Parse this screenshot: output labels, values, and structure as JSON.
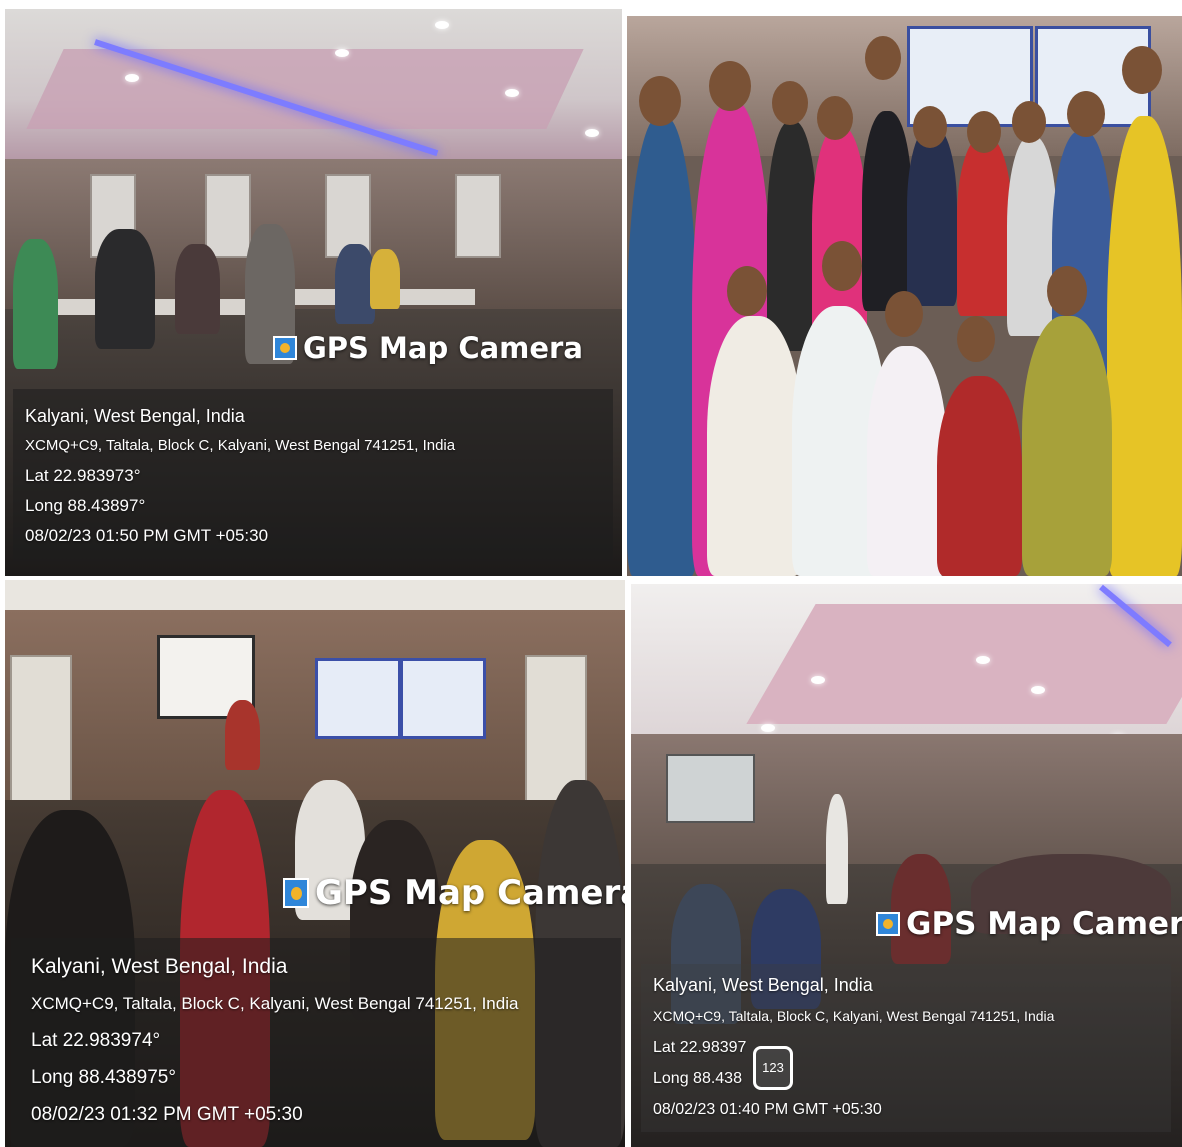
{
  "photos": [
    {
      "camera_label": "GPS Map Camera",
      "city": "Kalyani, West Bengal, India",
      "address": "XCMQ+C9, Taltala, Block C, Kalyani, West Bengal 741251, India",
      "lat": "Lat 22.983973°",
      "long": "Long 88.43897°",
      "datetime": "08/02/23 01:50 PM GMT +05:30"
    },
    {
      "description_visible_text": ""
    },
    {
      "camera_label": "GPS Map Camera",
      "city": "Kalyani, West Bengal, India",
      "address": "XCMQ+C9, Taltala, Block C, Kalyani, West Bengal 741251, India",
      "lat": "Lat 22.983974°",
      "long": "Long 88.438975°",
      "datetime": "08/02/23 01:32 PM GMT +05:30"
    },
    {
      "camera_label": "GPS Map Camera",
      "city": "Kalyani, West Bengal, India",
      "address": "XCMQ+C9, Taltala, Block C, Kalyani, West Bengal 741251, India",
      "lat": "Lat 22.98397",
      "long": "Long 88.438",
      "datetime": "08/02/23 01:40 PM GMT +05:30",
      "badge": "123"
    }
  ],
  "colors": {
    "overlay_text": "#ffffff",
    "logo_blue": "#2f86d9",
    "logo_yellow": "#f2b32a",
    "ceiling_led": "#7d7cff"
  },
  "icons": [
    "gps-map-camera-logo-icon"
  ]
}
